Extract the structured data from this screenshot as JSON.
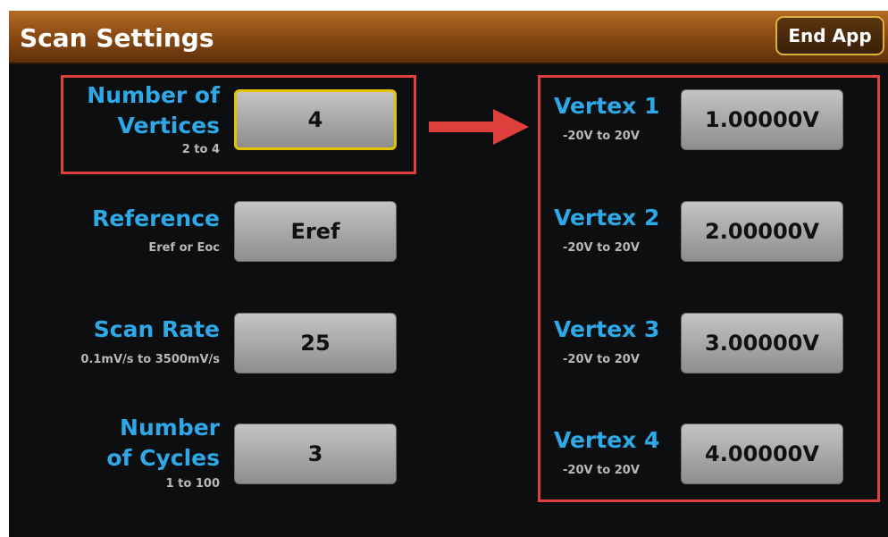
{
  "header": {
    "title": "Scan Settings",
    "end_app_label": "End App"
  },
  "left_settings": [
    {
      "label_lines": [
        "Number of",
        "Vertices"
      ],
      "range": "2 to 4",
      "value": "4"
    },
    {
      "label_lines": [
        "Reference"
      ],
      "range": "Eref or Eoc",
      "value": "Eref"
    },
    {
      "label_lines": [
        "Scan Rate"
      ],
      "range": "0.1mV/s to 3500mV/s",
      "value": "25"
    },
    {
      "label_lines": [
        "Number",
        "of Cycles"
      ],
      "range": "1 to 100",
      "value": "3"
    }
  ],
  "vertices": [
    {
      "label": "Vertex 1",
      "range": "-20V to 20V",
      "value": "1.00000V"
    },
    {
      "label": "Vertex 2",
      "range": "-20V to 20V",
      "value": "2.00000V"
    },
    {
      "label": "Vertex 3",
      "range": "-20V to 20V",
      "value": "3.00000V"
    },
    {
      "label": "Vertex 4",
      "range": "-20V to 20V",
      "value": "4.00000V"
    }
  ],
  "colors": {
    "accent_label": "#2ea8e6",
    "highlight_box": "#e0403d",
    "focus_border": "#e5c200",
    "titlebar": "#8d4d15"
  },
  "icons": {
    "arrow": "arrow-right-icon"
  }
}
